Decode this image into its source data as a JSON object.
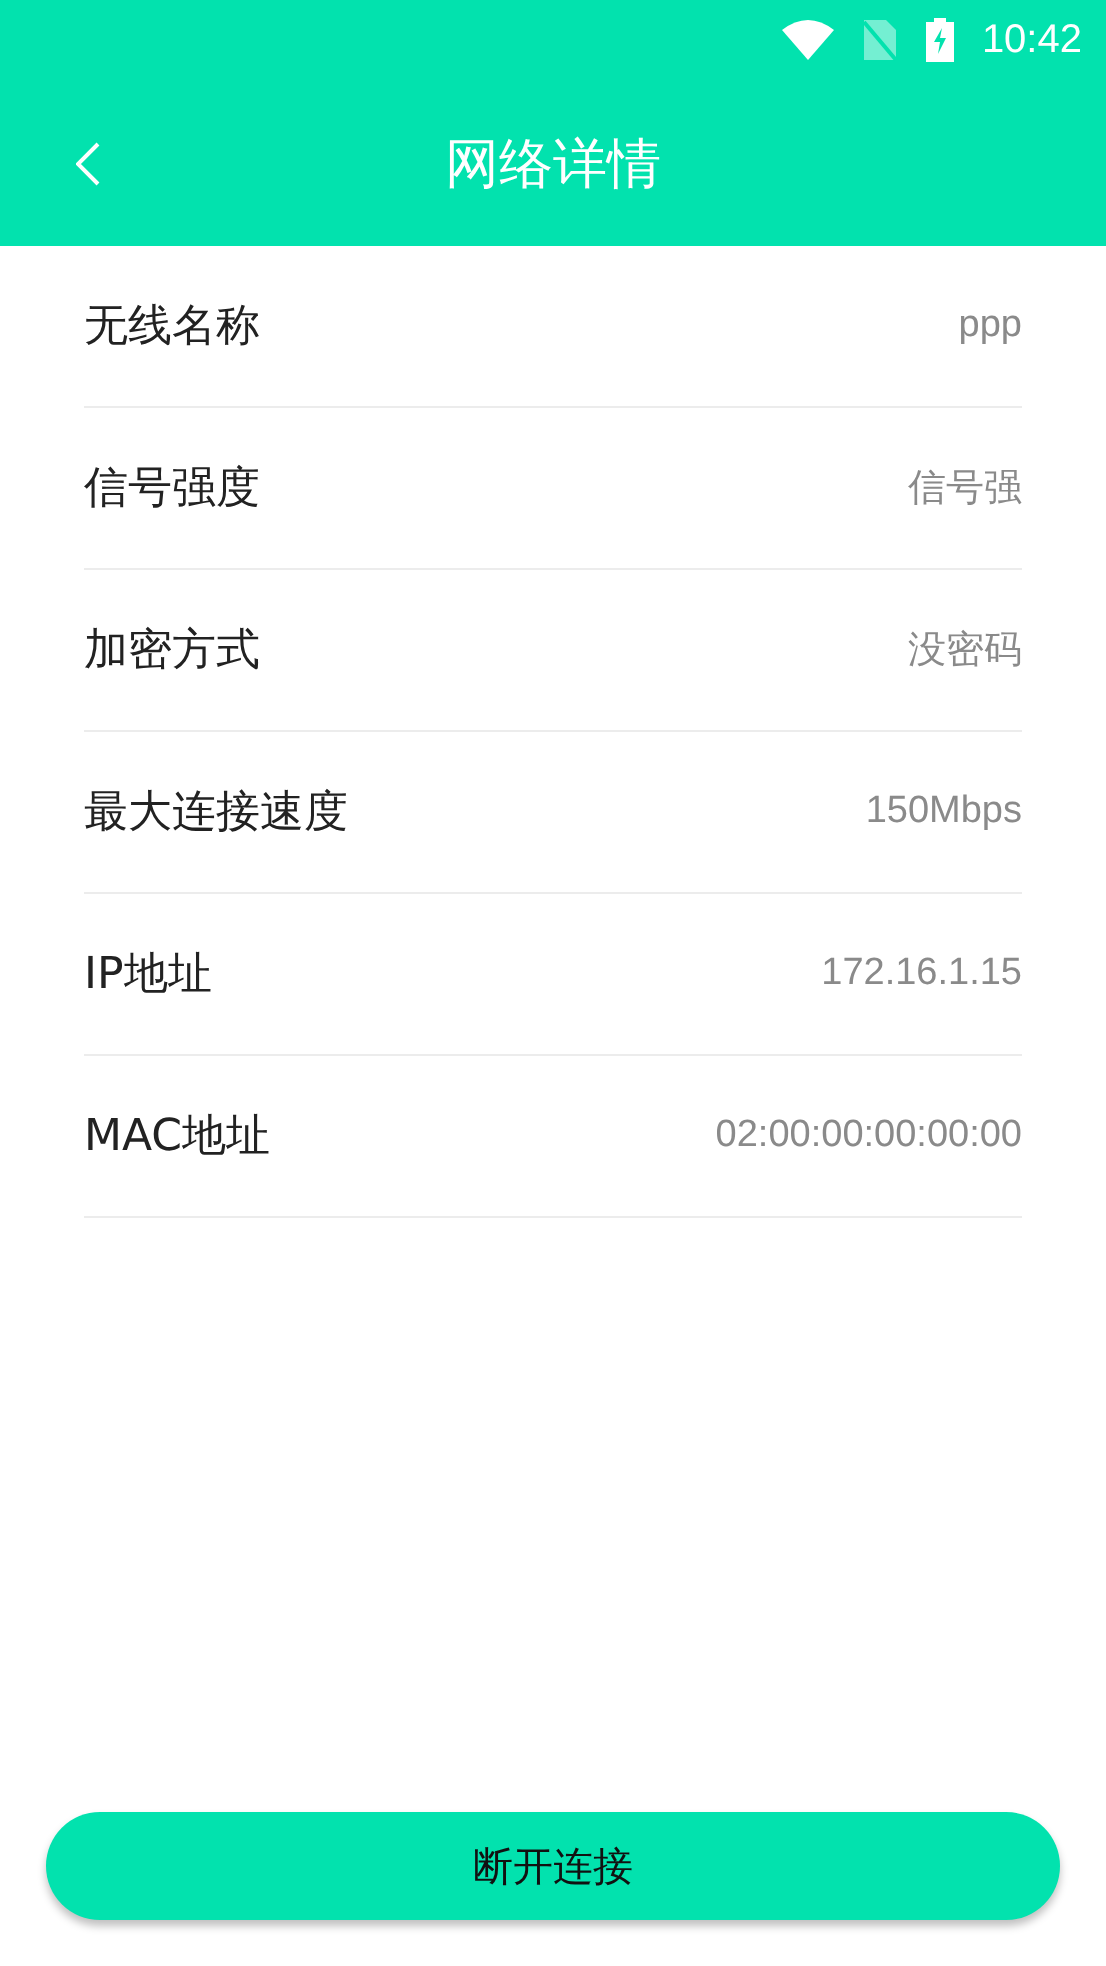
{
  "status_bar": {
    "time": "10:42"
  },
  "header": {
    "title": "网络详情"
  },
  "details": [
    {
      "label": "无线名称",
      "value": "ppp"
    },
    {
      "label": "信号强度",
      "value": "信号强"
    },
    {
      "label": "加密方式",
      "value": "没密码"
    },
    {
      "label": "最大连接速度",
      "value": "150Mbps"
    },
    {
      "label": "IP地址",
      "value": "172.16.1.15"
    },
    {
      "label": "MAC地址",
      "value": "02:00:00:00:00:00"
    }
  ],
  "button": {
    "label": "断开连接"
  }
}
